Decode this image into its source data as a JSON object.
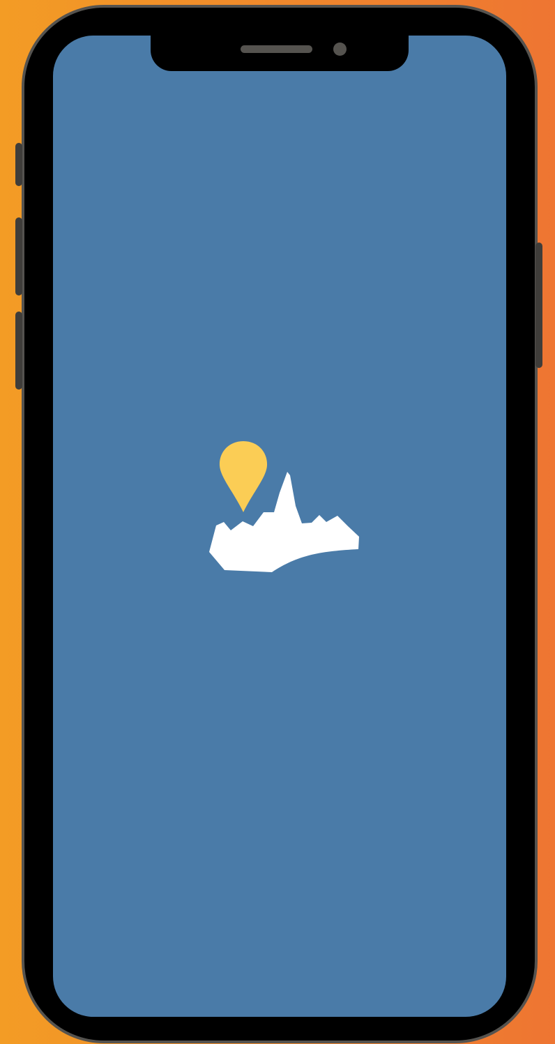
{
  "colors": {
    "background_left": "#f39c25",
    "background_right": "#ee7532",
    "phone_body": "#000000",
    "phone_bezel": "#55534f",
    "screen": "#4a7ba8",
    "pin": "#fbcd55",
    "landmark": "#ffffff"
  },
  "screen": {
    "type": "splash-screen"
  },
  "logo": {
    "pin_icon": "location-pin-icon",
    "landmark_icon": "city-skyline-icon"
  }
}
